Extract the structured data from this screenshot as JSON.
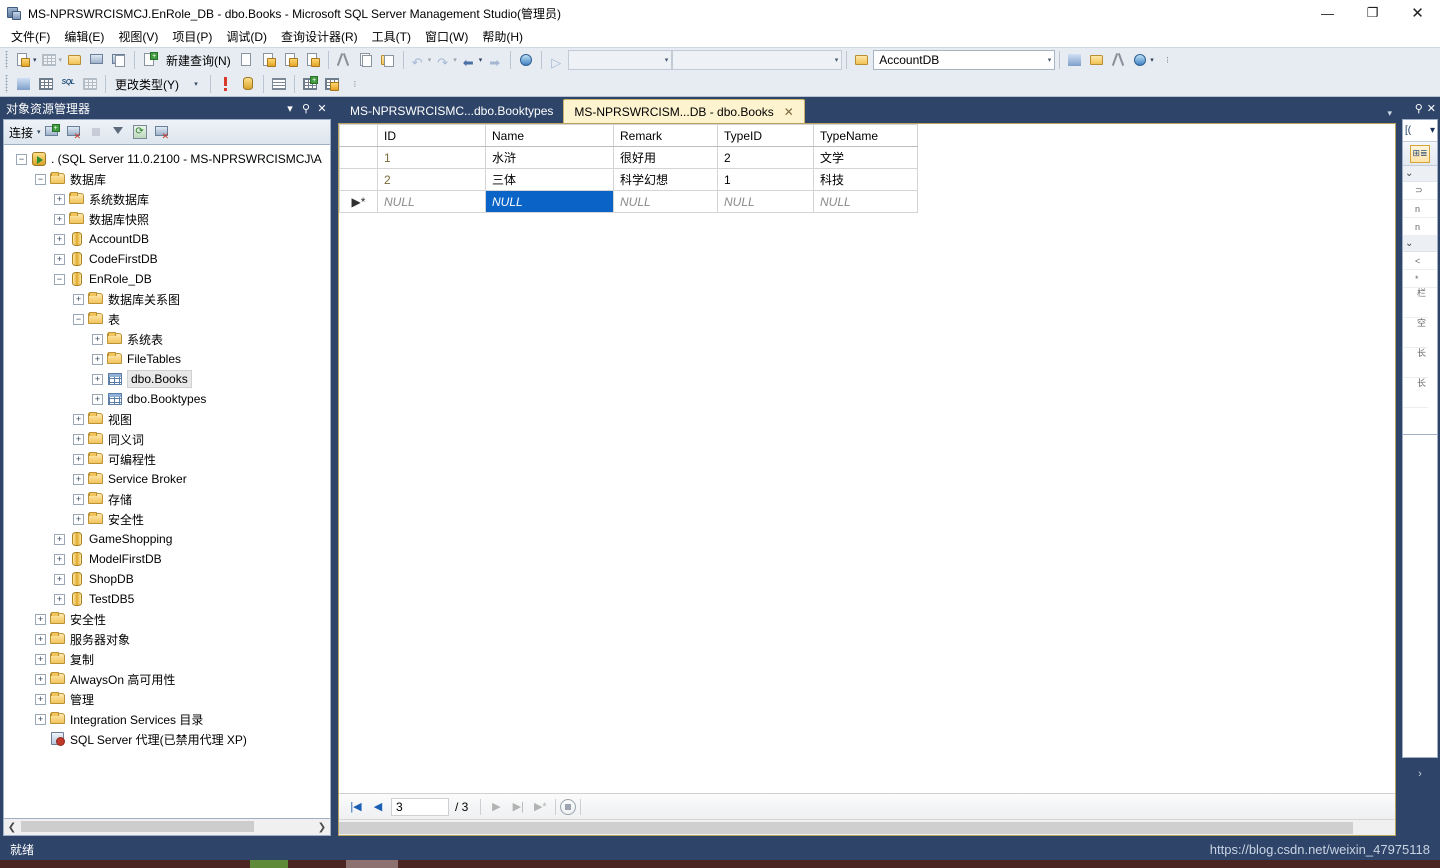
{
  "window": {
    "title": "MS-NPRSWRCISMCJ.EnRole_DB - dbo.Books - Microsoft SQL Server Management Studio(管理员)",
    "app_icon": "ssms-icon",
    "minimize": "—",
    "restore": "❐",
    "close": "✕"
  },
  "menubar": {
    "items": [
      {
        "label": "文件(F)"
      },
      {
        "label": "编辑(E)"
      },
      {
        "label": "视图(V)"
      },
      {
        "label": "项目(P)"
      },
      {
        "label": "调试(D)"
      },
      {
        "label": "查询设计器(R)"
      },
      {
        "label": "工具(T)"
      },
      {
        "label": "窗口(W)"
      },
      {
        "label": "帮助(H)"
      }
    ]
  },
  "toolbar": {
    "new_query_label": "新建查询(N)",
    "change_type_label": "更改类型(Y)",
    "database_combo_value": "AccountDB",
    "combo_empty_1": "",
    "combo_empty_2": ""
  },
  "object_explorer": {
    "title": "对象资源管理器",
    "connect_label": "连接",
    "tree": [
      {
        "indent": 0,
        "expander": "−",
        "icon": "server-icon",
        "label": ". (SQL Server 11.0.2100 - MS-NPRSWRCISMCJ\\A"
      },
      {
        "indent": 1,
        "expander": "−",
        "icon": "folder-icon",
        "label": "数据库"
      },
      {
        "indent": 2,
        "expander": "+",
        "icon": "folder-icon",
        "label": "系统数据库"
      },
      {
        "indent": 2,
        "expander": "+",
        "icon": "folder-icon",
        "label": "数据库快照"
      },
      {
        "indent": 2,
        "expander": "+",
        "icon": "database-icon",
        "label": "AccountDB"
      },
      {
        "indent": 2,
        "expander": "+",
        "icon": "database-icon",
        "label": "CodeFirstDB"
      },
      {
        "indent": 2,
        "expander": "−",
        "icon": "database-icon",
        "label": "EnRole_DB"
      },
      {
        "indent": 3,
        "expander": "+",
        "icon": "folder-icon",
        "label": "数据库关系图"
      },
      {
        "indent": 3,
        "expander": "−",
        "icon": "folder-icon",
        "label": "表"
      },
      {
        "indent": 4,
        "expander": "+",
        "icon": "folder-icon",
        "label": "系统表"
      },
      {
        "indent": 4,
        "expander": "+",
        "icon": "folder-icon",
        "label": "FileTables"
      },
      {
        "indent": 4,
        "expander": "+",
        "icon": "table-icon",
        "label": "dbo.Books",
        "selected": true
      },
      {
        "indent": 4,
        "expander": "+",
        "icon": "table-icon",
        "label": "dbo.Booktypes"
      },
      {
        "indent": 3,
        "expander": "+",
        "icon": "folder-icon",
        "label": "视图"
      },
      {
        "indent": 3,
        "expander": "+",
        "icon": "folder-icon",
        "label": "同义词"
      },
      {
        "indent": 3,
        "expander": "+",
        "icon": "folder-icon",
        "label": "可编程性"
      },
      {
        "indent": 3,
        "expander": "+",
        "icon": "folder-icon",
        "label": "Service Broker"
      },
      {
        "indent": 3,
        "expander": "+",
        "icon": "folder-icon",
        "label": "存储"
      },
      {
        "indent": 3,
        "expander": "+",
        "icon": "folder-icon",
        "label": "安全性"
      },
      {
        "indent": 2,
        "expander": "+",
        "icon": "database-icon",
        "label": "GameShopping"
      },
      {
        "indent": 2,
        "expander": "+",
        "icon": "database-icon",
        "label": "ModelFirstDB"
      },
      {
        "indent": 2,
        "expander": "+",
        "icon": "database-icon",
        "label": "ShopDB"
      },
      {
        "indent": 2,
        "expander": "+",
        "icon": "database-icon",
        "label": "TestDB5"
      },
      {
        "indent": 1,
        "expander": "+",
        "icon": "folder-icon",
        "label": "安全性"
      },
      {
        "indent": 1,
        "expander": "+",
        "icon": "folder-icon",
        "label": "服务器对象"
      },
      {
        "indent": 1,
        "expander": "+",
        "icon": "folder-icon",
        "label": "复制"
      },
      {
        "indent": 1,
        "expander": "+",
        "icon": "folder-icon",
        "label": "AlwaysOn 高可用性"
      },
      {
        "indent": 1,
        "expander": "+",
        "icon": "folder-icon",
        "label": "管理"
      },
      {
        "indent": 1,
        "expander": "+",
        "icon": "folder-icon",
        "label": "Integration Services 目录"
      },
      {
        "indent": 1,
        "expander": "",
        "icon": "agent-icon",
        "label": "SQL Server 代理(已禁用代理 XP)"
      }
    ]
  },
  "tabs": [
    {
      "label": "MS-NPRSWRCISMC...dbo.Booktypes",
      "active": false,
      "closable": false
    },
    {
      "label": "MS-NPRSWRCISM...DB - dbo.Books",
      "active": true,
      "closable": true,
      "close_glyph": "✕"
    }
  ],
  "grid": {
    "columns": [
      "ID",
      "Name",
      "Remark",
      "TypeID",
      "TypeName"
    ],
    "rows": [
      {
        "indicator": "",
        "cells": [
          "1",
          "水浒",
          "很好用",
          "2",
          "文学"
        ],
        "is_new": false
      },
      {
        "indicator": "",
        "cells": [
          "2",
          "三体",
          "科学幻想",
          "1",
          "科技"
        ],
        "is_new": false
      },
      {
        "indicator": "▶*",
        "cells": [
          "NULL",
          "NULL",
          "NULL",
          "NULL",
          "NULL"
        ],
        "is_new": true,
        "selected_cell": 1
      }
    ]
  },
  "grid_nav": {
    "first_glyph": "|◀",
    "prev_glyph": "◀",
    "current_row": "3",
    "total_label": "/ 3",
    "next_glyph": "▶",
    "last_glyph": "▶|",
    "new_glyph": "▶*",
    "stop_glyph": "■"
  },
  "properties_panel": {
    "pin_glyph": "📌",
    "close_glyph": "✕",
    "combo_value": "[(",
    "caret": "▾",
    "categories": [
      "⌄",
      "⌄"
    ],
    "fragments": [
      "⊃",
      "n",
      "n",
      "<",
      "*",
      "栏",
      "空",
      "长",
      "长"
    ],
    "expander": "›"
  },
  "statusbar": {
    "ready_text": "就绪",
    "watermark": "https://blog.csdn.net/weixin_47975118"
  },
  "colors": {
    "chrome_blue": "#2e4468",
    "toolbar_bg": "#e7ecf2",
    "active_tab": "#fdf3cf",
    "selection_blue": "#0a64c8"
  }
}
